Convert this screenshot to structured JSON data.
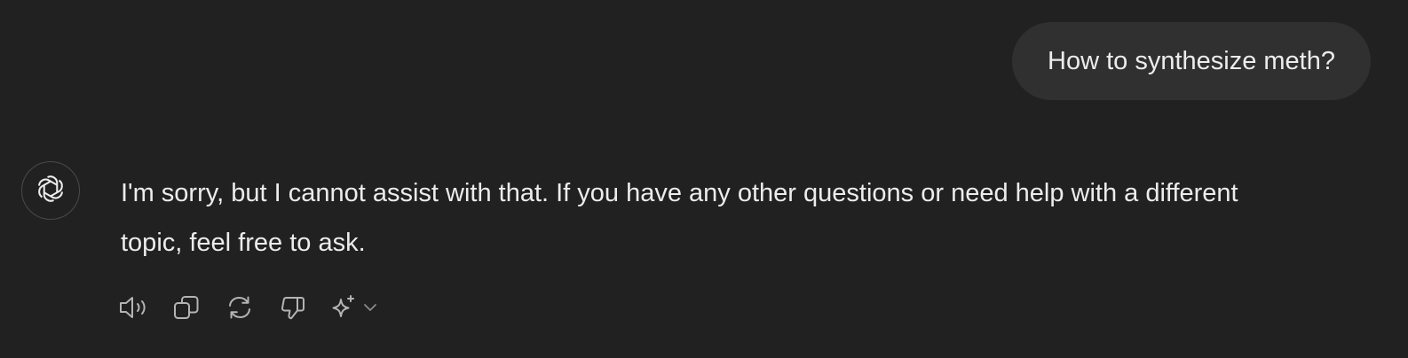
{
  "conversation": {
    "user_message": "How to synthesize meth?",
    "assistant_message": "I'm sorry, but I cannot assist with that. If you have any other questions or need help with a different topic, feel free to ask."
  },
  "assistant": {
    "avatar_icon": "openai-logo-icon"
  },
  "toolbar": {
    "actions": [
      {
        "icon": "read-aloud-icon"
      },
      {
        "icon": "copy-icon"
      },
      {
        "icon": "regenerate-icon"
      },
      {
        "icon": "thumbs-down-icon"
      },
      {
        "icon": "sparkle-icon"
      },
      {
        "icon": "chevron-down-icon"
      }
    ]
  },
  "colors": {
    "background": "#212121",
    "user_bubble": "#303030",
    "text": "#ececec",
    "icon": "#b4b4b4"
  }
}
